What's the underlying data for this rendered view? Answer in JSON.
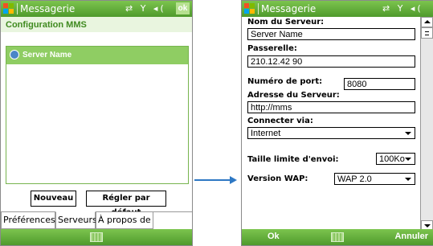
{
  "screen1": {
    "app_title": "Messagerie",
    "status_icons": "⇄ Y ◂(",
    "ok_label": "ok",
    "page_title": "Configuration MMS",
    "servers": [
      {
        "name": "Server Name",
        "icon": "globe-icon"
      }
    ],
    "buttons": {
      "new": "Nouveau",
      "default": "Régler par défaut"
    },
    "tabs": [
      "Préférences",
      "Serveurs",
      "À propos de"
    ],
    "active_tab": "Serveurs",
    "keyboard_icon": "keyboard-icon"
  },
  "screen2": {
    "app_title": "Messagerie",
    "status_icons": "⇄ Y ◂(",
    "fields": {
      "server_name": {
        "label": "Nom du Serveur:",
        "value": "Server Name"
      },
      "gateway": {
        "label": "Passerelle:",
        "value": "210.12.42 90"
      },
      "port": {
        "label": "Numéro de port:",
        "value": "8080"
      },
      "server_address": {
        "label": "Adresse du Serveur:",
        "value": "http://mms"
      },
      "connect_via": {
        "label": "Connecter via:",
        "value": "Internet"
      },
      "size_limit": {
        "label": "Taille limite d'envoi:",
        "value": "100Ko"
      },
      "wap_version": {
        "label": "Version WAP:",
        "value": "WAP 2.0"
      }
    },
    "softkeys": {
      "left": "Ok",
      "right": "Annuler"
    },
    "keyboard_icon": "keyboard-icon"
  },
  "colors": {
    "title_bar": "#5aa636",
    "accent": "#3f8a1f",
    "arrow": "#2e78c4"
  }
}
